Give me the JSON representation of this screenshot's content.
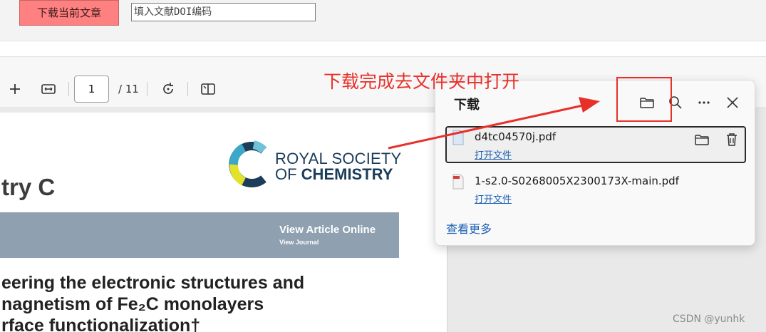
{
  "toolbar": {
    "download_label": "下载当前文章",
    "doi_placeholder": "填入文献DOI编码"
  },
  "pdf_toolbar": {
    "page_current": "1",
    "page_total": "/ 11",
    "icons": [
      "plus-icon",
      "fit-width-icon",
      "rotate-icon",
      "two-page-icon"
    ]
  },
  "document": {
    "journal_title": "try C",
    "publisher_line1": "ROYAL SOCIETY",
    "publisher_line2_prefix": "OF ",
    "publisher_line2_bold": "CHEMISTRY",
    "banner_main": "View Article Online",
    "banner_sub": "View Journal",
    "article_lines": [
      "eering the electronic structures and",
      "nagnetism of Fe₂C monolayers",
      "rface functionalization†"
    ]
  },
  "downloads": {
    "title": "下载",
    "items": [
      {
        "filename": "d4tc04570j.pdf",
        "action": "打开文件"
      },
      {
        "filename": "1-s2.0-S0268005X2300173X-main.pdf",
        "action": "打开文件"
      }
    ],
    "see_more": "查看更多"
  },
  "annotation": {
    "text": "下载完成去文件夹中打开",
    "color": "#e8302a"
  },
  "watermark": "CSDN @yunhk"
}
